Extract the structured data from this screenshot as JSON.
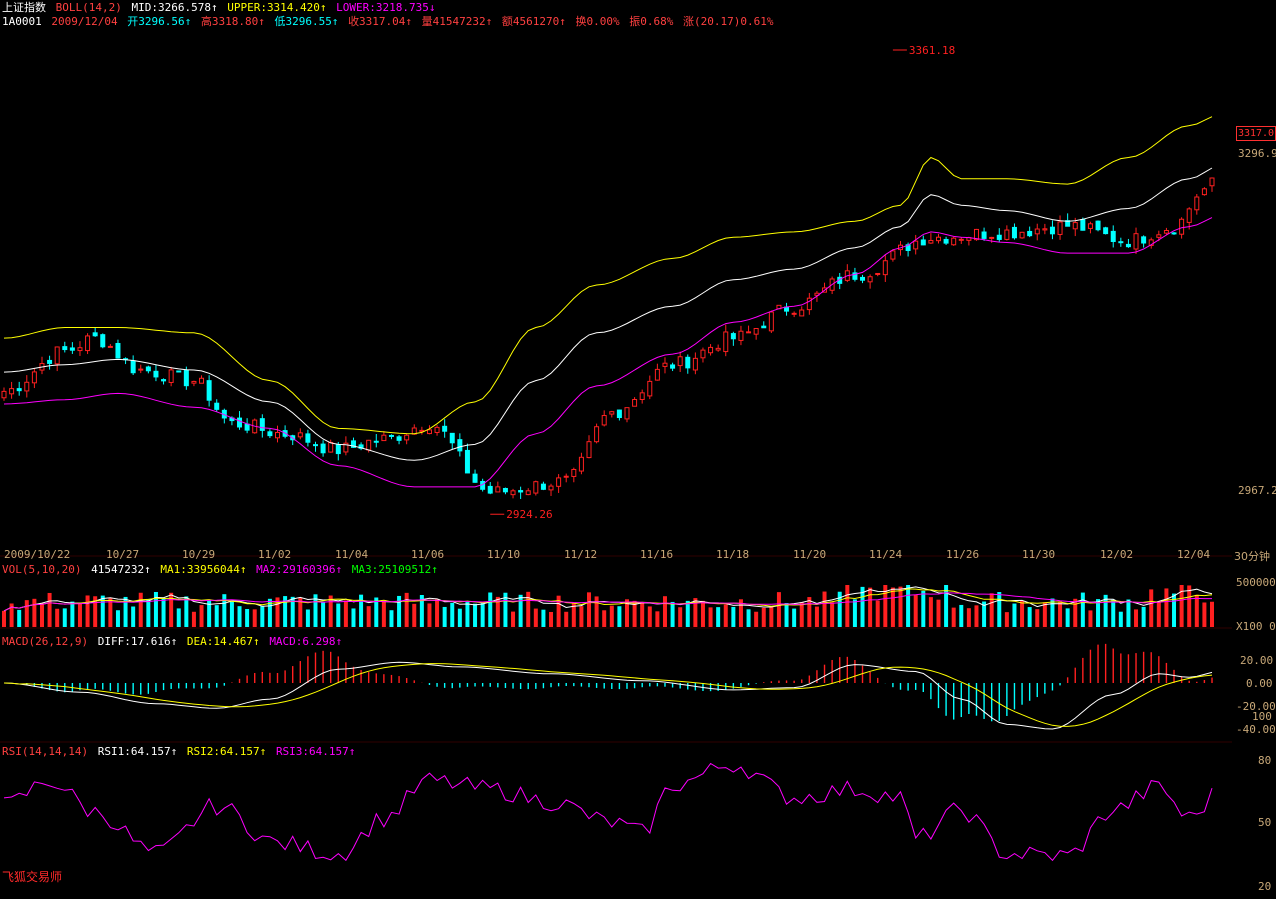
{
  "header": {
    "index_name": "上证指数",
    "boll_title": "BOLL(14,2)",
    "mid": "MID:3266.578↑",
    "upper": "UPPER:3314.420↑",
    "lower": "LOWER:3218.735↓",
    "code": "1A0001",
    "date": "2009/12/04",
    "open": "开3296.56↑",
    "high": "高3318.80↑",
    "low": "低3296.55↑",
    "close": "收3317.04↑",
    "volume": "量41547232↑",
    "amount": "额4561270↑",
    "turnover": "换0.00%",
    "amplitude": "振0.68%",
    "change": "涨(20.17)0.61%"
  },
  "indicators": {
    "vol": {
      "title": "VOL(5,10,20)",
      "value": "41547232↑",
      "ma1": "MA1:33956044↑",
      "ma2": "MA2:29160396↑",
      "ma3": "MA3:25109512↑"
    },
    "macd": {
      "title": "MACD(26,12,9)",
      "diff": "DIFF:17.616↑",
      "dea": "DEA:14.467↑",
      "macd": "MACD:6.298↑"
    },
    "rsi": {
      "title": "RSI(14,14,14)",
      "rsi1": "RSI1:64.157↑",
      "rsi2": "RSI2:64.157↑",
      "rsi3": "RSI3:64.157↑"
    }
  },
  "axes": {
    "price_top": "3296.9",
    "price_bottom": "2967.2",
    "last_price": "3317.0",
    "period": "30分钟",
    "vol_top": "500000",
    "vol_unit": "X100",
    "vol_zero": "0",
    "macd_ticks": [
      "20.00",
      "0.00",
      "-20.00",
      "-40.00"
    ],
    "macd_scale_note": "100",
    "rsi_ticks": [
      "80",
      "50",
      "20"
    ],
    "dates": [
      "2009/10/22",
      "10/27",
      "10/29",
      "11/02",
      "11/04",
      "11/06",
      "11/10",
      "11/12",
      "11/16",
      "11/18",
      "11/20",
      "11/24",
      "11/26",
      "11/30",
      "12/02",
      "12/04"
    ]
  },
  "annotations": {
    "high_label": "3361.18",
    "low_label": "2924.26"
  },
  "brand": "飞狐交易师",
  "colors": {
    "up": "#ff2020",
    "down": "#00ffff",
    "mid": "#ffffff",
    "upper": "#ffff00",
    "lower": "#ff00ff",
    "macd_diff": "#ffffff",
    "macd_dea": "#ffff00",
    "rsi": "#ff00ff",
    "vol_ma1": "#ffffff",
    "vol_ma2": "#ffff00",
    "vol_ma3": "#ff00ff",
    "text_label": "#c8a878"
  },
  "chart_data": {
    "type": "line",
    "bars": 160,
    "anchors": {
      "close": [
        [
          0,
          3040
        ],
        [
          8,
          3078
        ],
        [
          12,
          3090
        ],
        [
          18,
          3060
        ],
        [
          25,
          3050
        ],
        [
          30,
          3010
        ],
        [
          37,
          3000
        ],
        [
          44,
          2985
        ],
        [
          50,
          2995
        ],
        [
          56,
          3010
        ],
        [
          64,
          2945
        ],
        [
          74,
          2955
        ],
        [
          80,
          3020
        ],
        [
          88,
          3065
        ],
        [
          96,
          3090
        ],
        [
          104,
          3120
        ],
        [
          112,
          3150
        ],
        [
          122,
          3185
        ],
        [
          132,
          3190
        ],
        [
          140,
          3196
        ],
        [
          148,
          3182
        ],
        [
          154,
          3195
        ],
        [
          158,
          3230
        ],
        [
          160,
          3240
        ]
      ],
      "upper": [
        [
          0,
          3090
        ],
        [
          8,
          3100
        ],
        [
          15,
          3100
        ],
        [
          25,
          3095
        ],
        [
          35,
          3050
        ],
        [
          44,
          3005
        ],
        [
          54,
          3000
        ],
        [
          62,
          3030
        ],
        [
          70,
          3100
        ],
        [
          78,
          3140
        ],
        [
          88,
          3165
        ],
        [
          96,
          3185
        ],
        [
          104,
          3190
        ],
        [
          112,
          3200
        ],
        [
          118,
          3215
        ],
        [
          122,
          3260
        ],
        [
          126,
          3240
        ],
        [
          132,
          3240
        ],
        [
          140,
          3235
        ],
        [
          148,
          3260
        ],
        [
          156,
          3290
        ],
        [
          160,
          3300
        ]
      ],
      "mid": [
        [
          0,
          3058
        ],
        [
          8,
          3065
        ],
        [
          15,
          3070
        ],
        [
          25,
          3060
        ],
        [
          35,
          3030
        ],
        [
          44,
          2990
        ],
        [
          54,
          2975
        ],
        [
          62,
          2990
        ],
        [
          70,
          3050
        ],
        [
          78,
          3095
        ],
        [
          88,
          3120
        ],
        [
          96,
          3145
        ],
        [
          104,
          3155
        ],
        [
          112,
          3175
        ],
        [
          118,
          3195
        ],
        [
          122,
          3225
        ],
        [
          126,
          3215
        ],
        [
          132,
          3210
        ],
        [
          140,
          3200
        ],
        [
          148,
          3212
        ],
        [
          156,
          3240
        ],
        [
          160,
          3252
        ]
      ],
      "lower": [
        [
          0,
          3028
        ],
        [
          8,
          3032
        ],
        [
          15,
          3038
        ],
        [
          25,
          3025
        ],
        [
          35,
          3005
        ],
        [
          44,
          2970
        ],
        [
          54,
          2950
        ],
        [
          62,
          2950
        ],
        [
          70,
          3000
        ],
        [
          78,
          3045
        ],
        [
          88,
          3075
        ],
        [
          96,
          3105
        ],
        [
          104,
          3120
        ],
        [
          112,
          3150
        ],
        [
          118,
          3175
        ],
        [
          122,
          3190
        ],
        [
          126,
          3185
        ],
        [
          132,
          3180
        ],
        [
          140,
          3170
        ],
        [
          148,
          3170
        ],
        [
          156,
          3195
        ],
        [
          160,
          3205
        ]
      ]
    },
    "price_ylim": [
      2900,
      3380
    ],
    "high": 3361.18,
    "low": 2924.26
  }
}
